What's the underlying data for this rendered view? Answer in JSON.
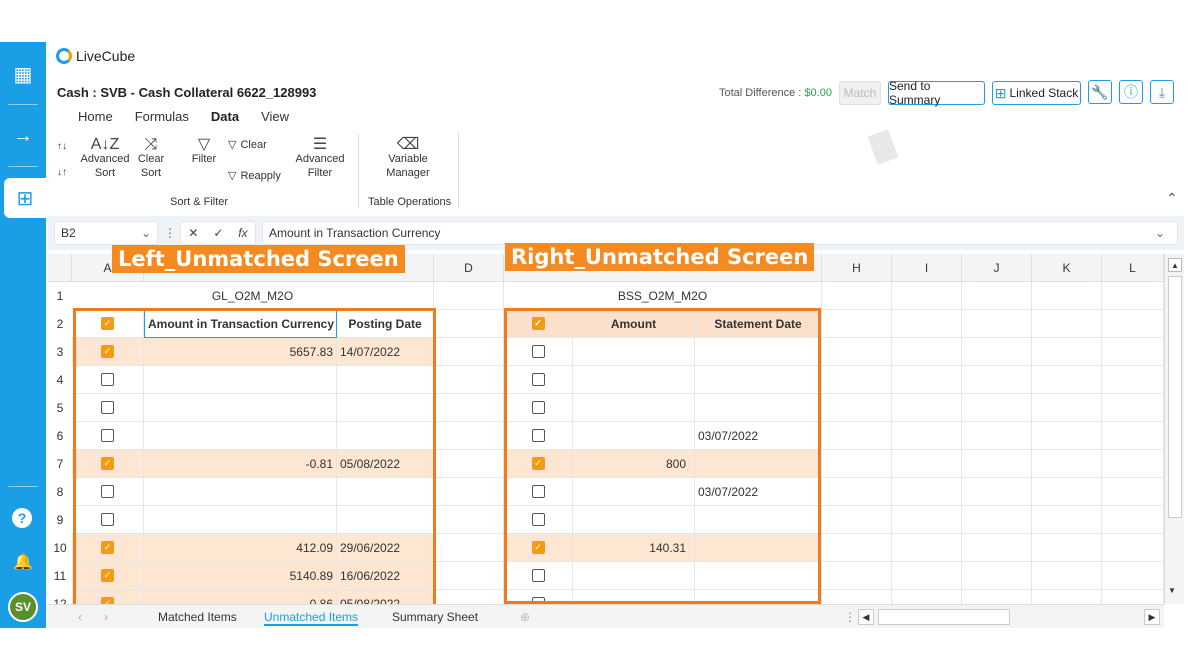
{
  "app": {
    "name": "LiveCube",
    "doc_title": "Cash : SVB - Cash Collateral 6622_128993"
  },
  "menu": {
    "tabs": [
      "Home",
      "Formulas",
      "Data",
      "View"
    ],
    "active": "Data"
  },
  "header": {
    "total_diff_label": "Total Difference : ",
    "total_diff_value": "$0.00",
    "match_btn": "Match",
    "send_btn": "Send to Summary",
    "linked_btn": "Linked Stack"
  },
  "ribbon": {
    "advanced_sort": "Advanced\nSort",
    "clear_sort": "Clear\nSort",
    "filter": "Filter",
    "clear": "Clear",
    "reapply": "Reapply",
    "advanced_filter": "Advanced\nFilter",
    "variable_manager": "Variable\nManager",
    "group_sort_filter": "Sort & Filter",
    "group_table_ops": "Table Operations"
  },
  "formula_bar": {
    "cell_ref": "B2",
    "content": "Amount in Transaction Currency"
  },
  "columns": [
    "A",
    "D",
    "H",
    "I",
    "J",
    "K",
    "L"
  ],
  "rows": [
    "1",
    "2",
    "3",
    "4",
    "5",
    "6",
    "7",
    "8",
    "9",
    "10",
    "11",
    "12"
  ],
  "left_panel": {
    "title": "GL_O2M_M2O",
    "label": "Left_Unmatched Screen",
    "header_amount": "Amount in Transaction Currency",
    "header_date": "Posting Date",
    "rows": [
      {
        "checked": true,
        "amount": "5657.83",
        "date": "14/07/2022"
      },
      {
        "checked": false,
        "amount": "",
        "date": ""
      },
      {
        "checked": false,
        "amount": "",
        "date": ""
      },
      {
        "checked": false,
        "amount": "",
        "date": ""
      },
      {
        "checked": true,
        "amount": "-0.81",
        "date": "05/08/2022"
      },
      {
        "checked": false,
        "amount": "",
        "date": ""
      },
      {
        "checked": false,
        "amount": "",
        "date": ""
      },
      {
        "checked": true,
        "amount": "412.09",
        "date": "29/06/2022"
      },
      {
        "checked": true,
        "amount": "5140.89",
        "date": "16/06/2022"
      },
      {
        "checked": true,
        "amount": "0.86",
        "date": "05/08/2022"
      }
    ]
  },
  "right_panel": {
    "title": "BSS_O2M_M2O",
    "label": "Right_Unmatched Screen",
    "header_amount": "Amount",
    "header_date": "Statement Date",
    "rows": [
      {
        "checked": false,
        "amount": "",
        "date": ""
      },
      {
        "checked": false,
        "amount": "",
        "date": ""
      },
      {
        "checked": false,
        "amount": "",
        "date": ""
      },
      {
        "checked": false,
        "amount": "",
        "date": "03/07/2022"
      },
      {
        "checked": true,
        "amount": "800",
        "date": ""
      },
      {
        "checked": false,
        "amount": "",
        "date": "03/07/2022"
      },
      {
        "checked": false,
        "amount": "",
        "date": ""
      },
      {
        "checked": true,
        "amount": "140.31",
        "date": ""
      },
      {
        "checked": false,
        "amount": "",
        "date": ""
      },
      {
        "checked": false,
        "amount": "",
        "date": ""
      }
    ]
  },
  "sheets": {
    "tabs": [
      "Matched Items",
      "Unmatched Items",
      "Summary Sheet"
    ],
    "active": "Unmatched Items"
  },
  "user": {
    "initials": "SV"
  },
  "colors": {
    "accent": "#1a9fe6",
    "highlight": "#fde6d2",
    "frame": "#f07b1e",
    "success": "#2ea44f"
  }
}
